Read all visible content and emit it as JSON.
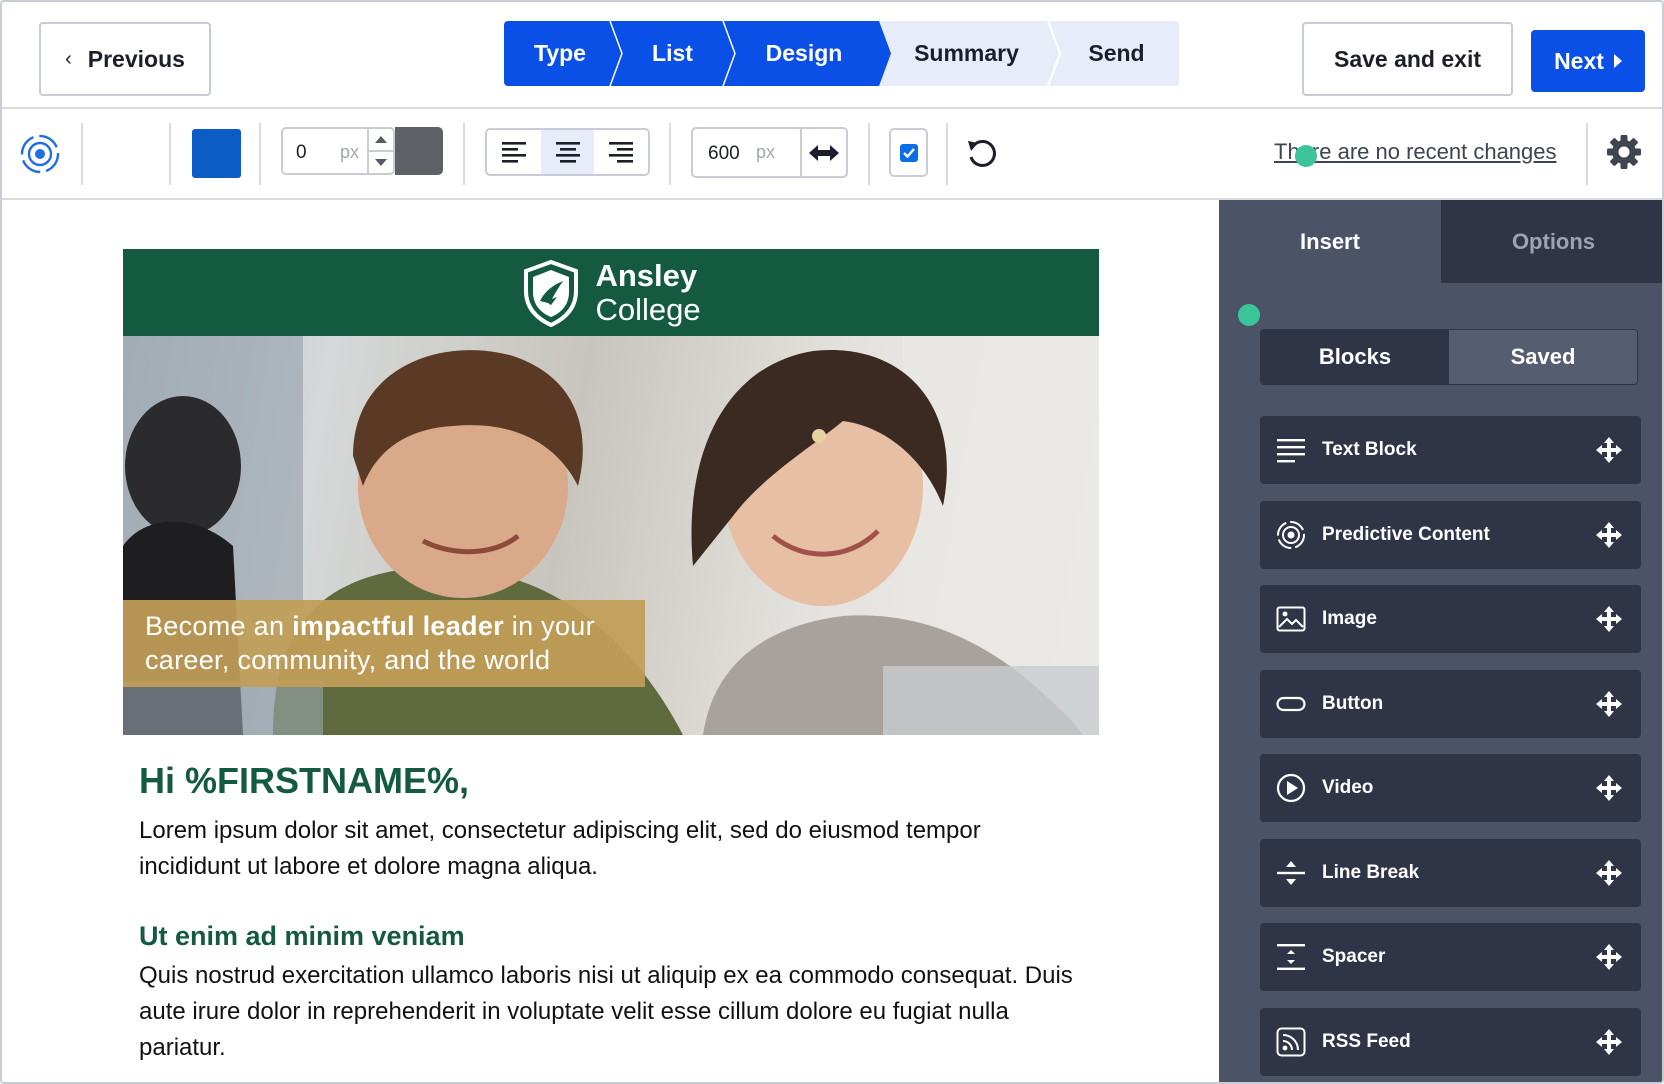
{
  "header": {
    "previous_label": "Previous",
    "steps": [
      {
        "label": "Type",
        "state": "completed"
      },
      {
        "label": "List",
        "state": "completed"
      },
      {
        "label": "Design",
        "state": "current"
      },
      {
        "label": "Summary",
        "state": "upcoming"
      },
      {
        "label": "Send",
        "state": "upcoming"
      }
    ],
    "save_exit_label": "Save and exit",
    "next_label": "Next"
  },
  "toolbar": {
    "background_color": "#0b5cc4",
    "border_value": "0",
    "border_unit": "px",
    "border_color": "#5e6066",
    "alignment_selected": "center",
    "width_value": "600",
    "width_unit": "px",
    "checkbox_checked": true,
    "recent_changes_text": "There are no recent changes"
  },
  "email": {
    "brand_name_line1": "Ansley",
    "brand_name_line2": "College",
    "brand_color": "#145a41",
    "hero_caption_pre": "Become an ",
    "hero_caption_bold": "impactful leader",
    "hero_caption_post": " in your career, community, and the world",
    "greeting": "Hi %FIRSTNAME%,",
    "paragraph1": "Lorem ipsum dolor sit amet, consectetur adipiscing elit, sed do eiusmod tempor incididunt ut labore et dolore magna aliqua.",
    "subheading": "Ut enim ad minim veniam",
    "paragraph2": "Quis nostrud exercitation ullamco laboris nisi ut aliquip ex ea commodo consequat. Duis aute irure dolor in reprehenderit in voluptate velit esse cillum dolore eu fugiat nulla pariatur."
  },
  "panel": {
    "tabs": [
      {
        "label": "Insert",
        "active": true
      },
      {
        "label": "Options",
        "active": false
      }
    ],
    "subtabs": [
      {
        "label": "Blocks",
        "active": true
      },
      {
        "label": "Saved",
        "active": false
      }
    ],
    "blocks": [
      {
        "label": "Text Block",
        "icon": "text-lines-icon"
      },
      {
        "label": "Predictive Content",
        "icon": "predictive-target-icon"
      },
      {
        "label": "Image",
        "icon": "image-icon"
      },
      {
        "label": "Button",
        "icon": "button-pill-icon"
      },
      {
        "label": "Video",
        "icon": "play-circle-icon"
      },
      {
        "label": "Line Break",
        "icon": "line-break-icon"
      },
      {
        "label": "Spacer",
        "icon": "spacer-icon"
      },
      {
        "label": "RSS Feed",
        "icon": "rss-icon"
      }
    ]
  }
}
